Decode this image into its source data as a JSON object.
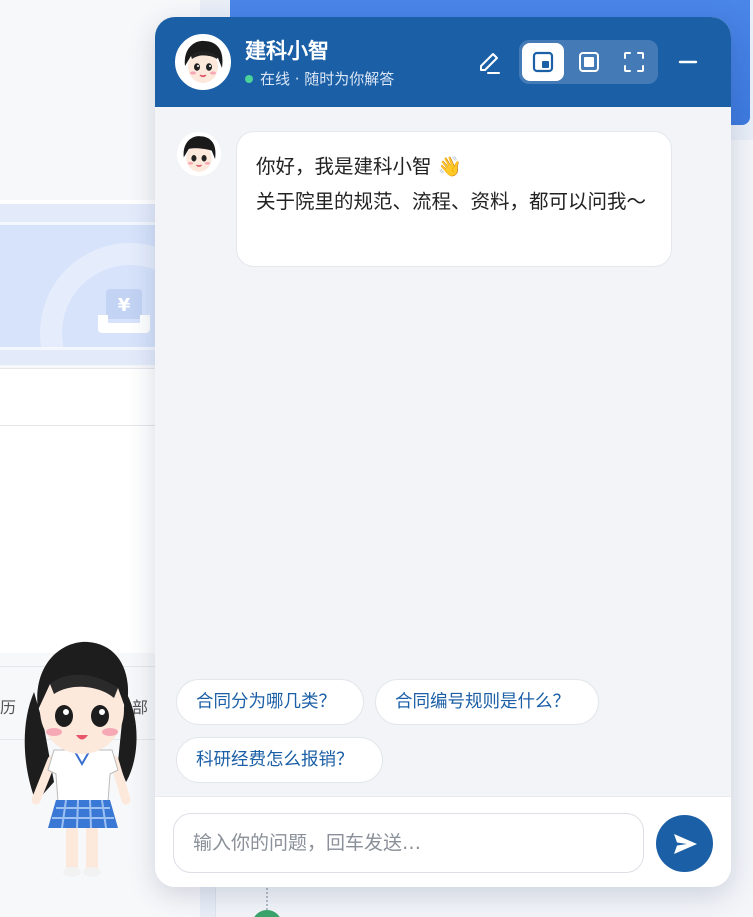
{
  "background": {
    "row_text_left": "历",
    "row_text_right": "部"
  },
  "chat": {
    "title": "建科小智",
    "status": "在线 · 随时为你解答",
    "greeting_line1": "你好，我是建科小智 👋",
    "greeting_line2": "关于院里的规范、流程、资料，都可以问我～",
    "suggestions": [
      "合同分为哪几类？",
      "合同编号规则是什么？",
      "科研经费怎么报销？"
    ],
    "input_placeholder": "输入你的问题，回车发送…",
    "accent_color": "#1b5fa6"
  }
}
